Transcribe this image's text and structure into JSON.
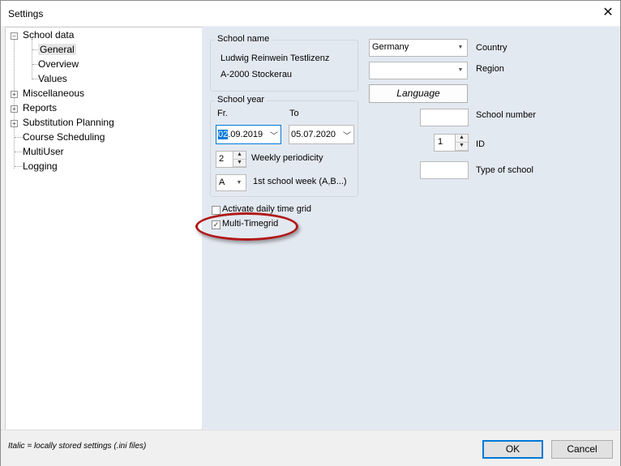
{
  "window": {
    "title": "Settings"
  },
  "tree": {
    "items": [
      {
        "label": "School data"
      },
      {
        "label": "General"
      },
      {
        "label": "Overview"
      },
      {
        "label": "Values"
      },
      {
        "label": "Miscellaneous"
      },
      {
        "label": "Reports"
      },
      {
        "label": "Substitution Planning"
      },
      {
        "label": "Course Scheduling"
      },
      {
        "label": "MultiUser"
      },
      {
        "label": "Logging"
      }
    ]
  },
  "school_name": {
    "group_label": "School name",
    "line1": "Ludwig Reinwein Testlizenz",
    "line2": "A-2000 Stockerau"
  },
  "school_year": {
    "group_label": "School year",
    "from_label": "Fr.",
    "to_label": "To",
    "from_value_highlight": "02",
    "from_value_rest": ".09.2019",
    "to_value": "05.07.2020",
    "periodicity_value": "2",
    "periodicity_label": "Weekly periodicity",
    "first_week_value": "A",
    "first_week_label": "1st school week (A,B...)"
  },
  "right": {
    "country_value": "Germany",
    "country_label": "Country",
    "region_value": "",
    "region_label": "Region",
    "language_button": "Language",
    "school_number_value": "",
    "school_number_label": "School number",
    "id_value": "1",
    "id_label": "ID",
    "type_value": "",
    "type_label": "Type of school"
  },
  "options": {
    "daily_grid_label": "Activate daily time grid",
    "multi_timegrid_label": "Multi-Timegrid",
    "multi_timegrid_checked": true
  },
  "footer": {
    "note": "Italic = locally stored settings (.ini files)",
    "ok_label": "OK",
    "cancel_label": "Cancel"
  },
  "colors": {
    "highlight_ellipse": "#b01818",
    "selection": "#0078d7"
  }
}
